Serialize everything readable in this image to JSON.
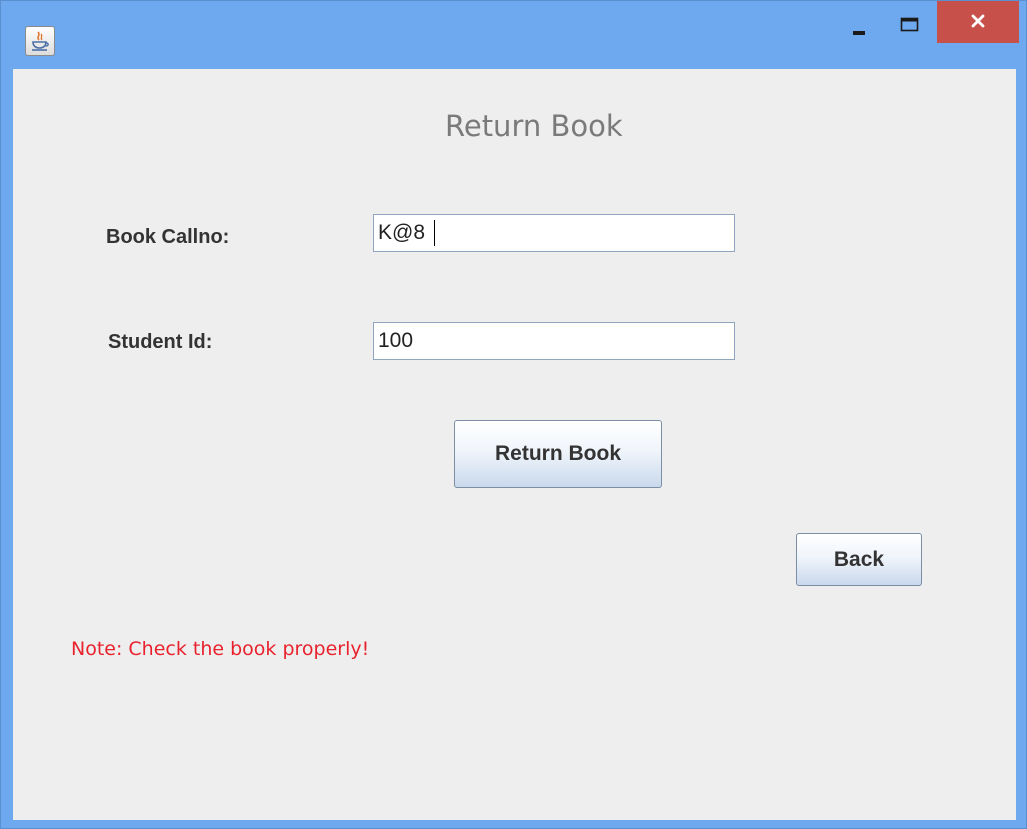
{
  "window": {
    "icon": "java-coffee-icon",
    "controls": {
      "minimize": "minimize-icon",
      "maximize": "maximize-icon",
      "close": "close-icon"
    }
  },
  "form": {
    "title": "Return Book",
    "callno_label": "Book Callno:",
    "callno_value": "K@8",
    "student_label": "Student Id:",
    "student_value": "100",
    "return_button": "Return Book",
    "back_button": "Back",
    "note": "Note: Check the book properly!"
  },
  "colors": {
    "titlebar": "#6ea8ee",
    "close": "#c7504b",
    "note": "#e8232e"
  }
}
